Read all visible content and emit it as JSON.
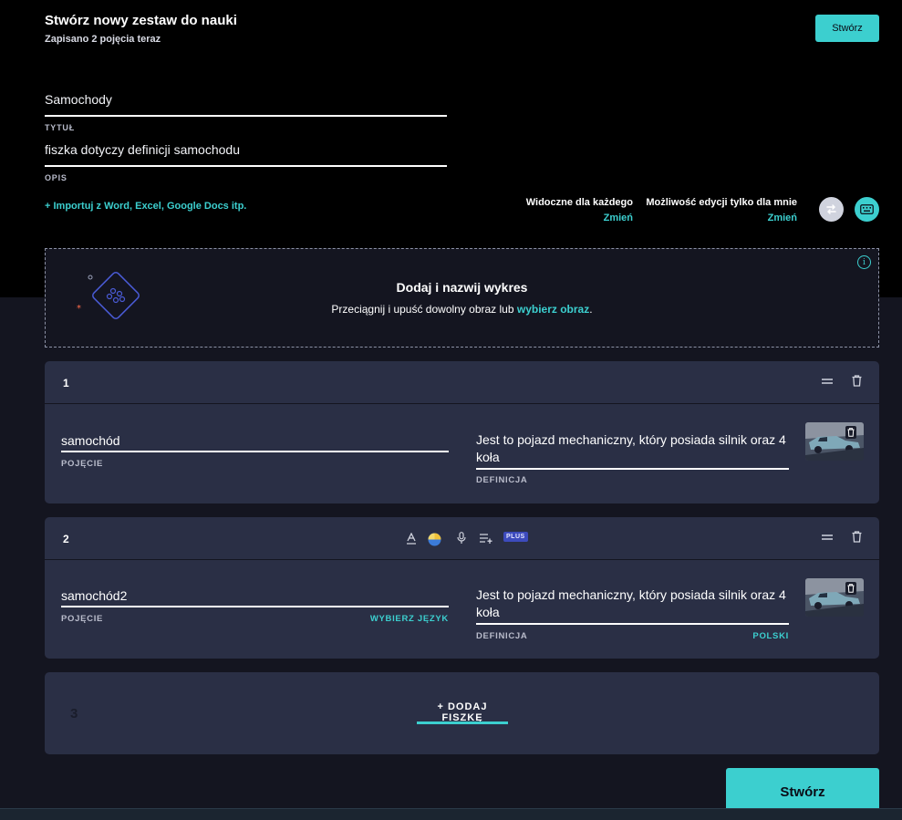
{
  "header": {
    "title": "Stwórz nowy zestaw do nauki",
    "subtitle": "Zapisano 2 pojęcia teraz",
    "create_label": "Stwórz"
  },
  "set": {
    "title_value": "Samochody",
    "title_label": "TYTUŁ",
    "desc_value": "fiszka dotyczy definicji samochodu",
    "desc_label": "OPIS",
    "import_link": "+ Importuj z Word, Excel, Google Docs itp."
  },
  "visibility": {
    "visible_label": "Widoczne dla każdego",
    "visible_change": "Zmień",
    "edit_label": "Możliwość edycji tylko dla mnie",
    "edit_change": "Zmień"
  },
  "diagram": {
    "title": "Dodaj i nazwij wykres",
    "text_before": "Przeciągnij i upuść dowolny obraz lub ",
    "link": "wybierz obraz",
    "text_after": "."
  },
  "cards": [
    {
      "number": "1",
      "term": "samochód",
      "term_label": "POJĘCIE",
      "definition": "Jest to pojazd mechaniczny, który posiada silnik oraz 4 koła",
      "def_label": "DEFINICJA"
    },
    {
      "number": "2",
      "term": "samochód2",
      "term_label": "POJĘCIE",
      "term_lang": "WYBIERZ JĘZYK",
      "definition": "Jest to pojazd mechaniczny, który posiada silnik oraz 4 koła",
      "def_label": "DEFINICJA",
      "def_lang": "POLSKI",
      "plus_badge": "PLUS"
    }
  ],
  "add_card": {
    "number": "3",
    "label": "+ DODAJ FISZKĘ"
  },
  "footer": {
    "create_label": "Stwórz"
  },
  "colors": {
    "accent": "#3ccfcf",
    "background": "#141520",
    "card": "#2a2f45",
    "header": "#000000"
  }
}
